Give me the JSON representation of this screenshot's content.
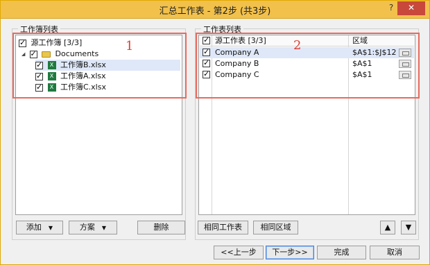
{
  "window": {
    "title": "汇总工作表 - 第2步 (共3步)",
    "help": "?",
    "close": "✕"
  },
  "left": {
    "group_label": "工作簿列表",
    "badge": "1",
    "tree": [
      {
        "label": "源工作簿 [3/3]",
        "checked": true
      },
      {
        "label": "Documents",
        "checked": true
      },
      {
        "label": "工作簿B.xlsx",
        "checked": true
      },
      {
        "label": "工作簿A.xlsx",
        "checked": true
      },
      {
        "label": "工作簿C.xlsx",
        "checked": true
      }
    ],
    "buttons": {
      "add": "添加",
      "scheme": "方案",
      "delete": "删除"
    }
  },
  "right": {
    "group_label": "工作表列表",
    "badge": "2",
    "header": {
      "sheet": "源工作表 [3/3]",
      "range": "区域"
    },
    "rows": [
      {
        "sheet": "Company A",
        "range": "$A$1:$J$12",
        "checked": true
      },
      {
        "sheet": "Company B",
        "range": "$A$1",
        "checked": true
      },
      {
        "sheet": "Company C",
        "range": "$A$1",
        "checked": true
      }
    ],
    "buttons": {
      "same_sheet": "相同工作表",
      "same_range": "相同区域",
      "up": "▲",
      "down": "▼"
    }
  },
  "footer": {
    "prev": "<<上一步",
    "next": "下一步>>",
    "finish": "完成",
    "cancel": "取消"
  }
}
